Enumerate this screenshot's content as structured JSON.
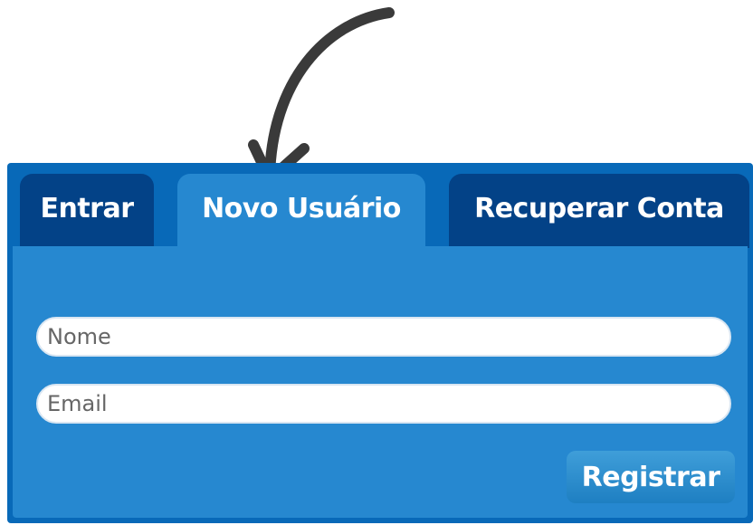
{
  "tabs": [
    {
      "label": "Entrar",
      "active": false
    },
    {
      "label": "Novo Usuário",
      "active": true
    },
    {
      "label": "Recuperar Conta",
      "active": false
    }
  ],
  "form": {
    "name_placeholder": "Nome",
    "email_placeholder": "Email",
    "submit_label": "Registrar"
  },
  "colors": {
    "panel_blue": "#0869b8",
    "active_tab": "#2688d0",
    "inactive_tab": "#034287",
    "annotation_arrow": "#3a3a3a"
  },
  "icons": {
    "annotation": "curved-arrow-icon"
  }
}
